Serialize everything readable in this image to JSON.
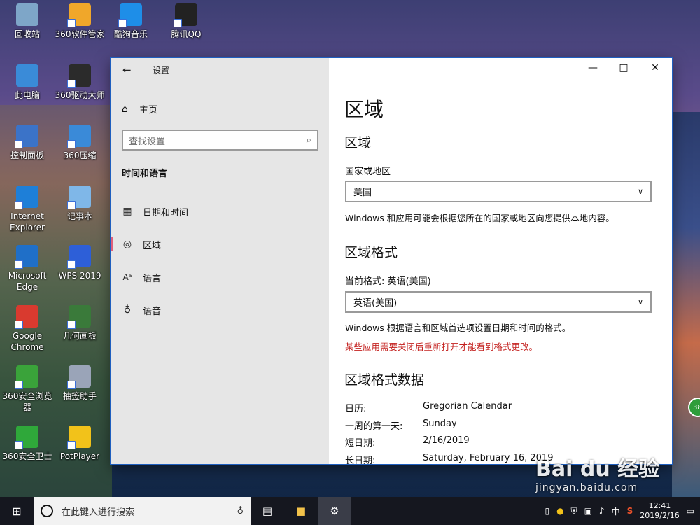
{
  "desktop_icons": [
    {
      "label": "回收站",
      "icon": "recycle-bin-icon",
      "color": "#7ea6c8"
    },
    {
      "label": "360软件管家",
      "icon": "360-software-manager-icon",
      "color": "#f0a72a"
    },
    {
      "label": "酷狗音乐",
      "icon": "kugou-music-icon",
      "color": "#1e8ee8"
    },
    {
      "label": "腾讯QQ",
      "icon": "qq-penguin-icon",
      "color": "#222222"
    },
    {
      "label": "此电脑",
      "icon": "computer-icon",
      "color": "#3a8bd8"
    },
    {
      "label": "360驱动大师",
      "icon": "360-driver-master-icon",
      "color": "#2b2b2b"
    },
    {
      "label": "控制面板",
      "icon": "control-panel-icon",
      "color": "#3b73c8"
    },
    {
      "label": "360压缩",
      "icon": "360-zip-icon",
      "color": "#3a8ad8"
    },
    {
      "label": "Internet Explorer",
      "icon": "ie-icon",
      "color": "#1e7fd8"
    },
    {
      "label": "记事本",
      "icon": "notepad-icon",
      "color": "#7fb7e8"
    },
    {
      "label": "Microsoft Edge",
      "icon": "edge-icon",
      "color": "#1f6fc8"
    },
    {
      "label": "WPS 2019",
      "icon": "wps-icon",
      "color": "#2d5fd8"
    },
    {
      "label": "Google Chrome",
      "icon": "chrome-icon",
      "color": "#d93a2f"
    },
    {
      "label": "几何画板",
      "icon": "geometry-sketchpad-icon",
      "color": "#3a7a3a"
    },
    {
      "label": "360安全浏览器",
      "icon": "360-browser-icon",
      "color": "#3aa33a"
    },
    {
      "label": "抽签助手",
      "icon": "lottery-helper-icon",
      "color": "#9aa4b8"
    },
    {
      "label": "360安全卫士",
      "icon": "360-security-icon",
      "color": "#2fa83a"
    },
    {
      "label": "PotPlayer",
      "icon": "potplayer-icon",
      "color": "#f2c21a"
    }
  ],
  "window": {
    "app_title": "设置",
    "nav": {
      "home": "主页",
      "search_placeholder": "查找设置",
      "section_title": "时间和语言",
      "items": [
        {
          "label": "日期和时间",
          "icon": "calendar-clock-icon"
        },
        {
          "label": "区域",
          "icon": "globe-icon"
        },
        {
          "label": "语言",
          "icon": "language-icon"
        },
        {
          "label": "语音",
          "icon": "microphone-icon"
        }
      ]
    },
    "content": {
      "title": "区域",
      "region_heading": "区域",
      "country_label": "国家或地区",
      "country_value": "美国",
      "country_desc": "Windows 和应用可能会根据您所在的国家或地区向您提供本地内容。",
      "format_heading": "区域格式",
      "current_format_label": "当前格式: 英语(美国)",
      "format_value": "英语(美国)",
      "format_desc": "Windows 根据语言和区域首选项设置日期和时间的格式。",
      "format_warning": "某些应用需要关闭后重新打开才能看到格式更改。",
      "data_heading": "区域格式数据",
      "data_rows": [
        {
          "key": "日历:",
          "value": "Gregorian Calendar"
        },
        {
          "key": "一周的第一天:",
          "value": "Sunday"
        },
        {
          "key": "短日期:",
          "value": "2/16/2019"
        },
        {
          "key": "长日期:",
          "value": "Saturday, February 16, 2019"
        }
      ]
    }
  },
  "taskbar": {
    "search_placeholder": "在此键入进行搜索",
    "ime": "中",
    "time": "12:41",
    "date": "2019/2/16"
  },
  "watermark": {
    "brand": "Bai du 经验",
    "url": "jingyan.baidu.com"
  },
  "badge": "38",
  "colors": {
    "accent": "#e0607c",
    "warning": "#c4211f",
    "taskbar": "#15171f"
  }
}
